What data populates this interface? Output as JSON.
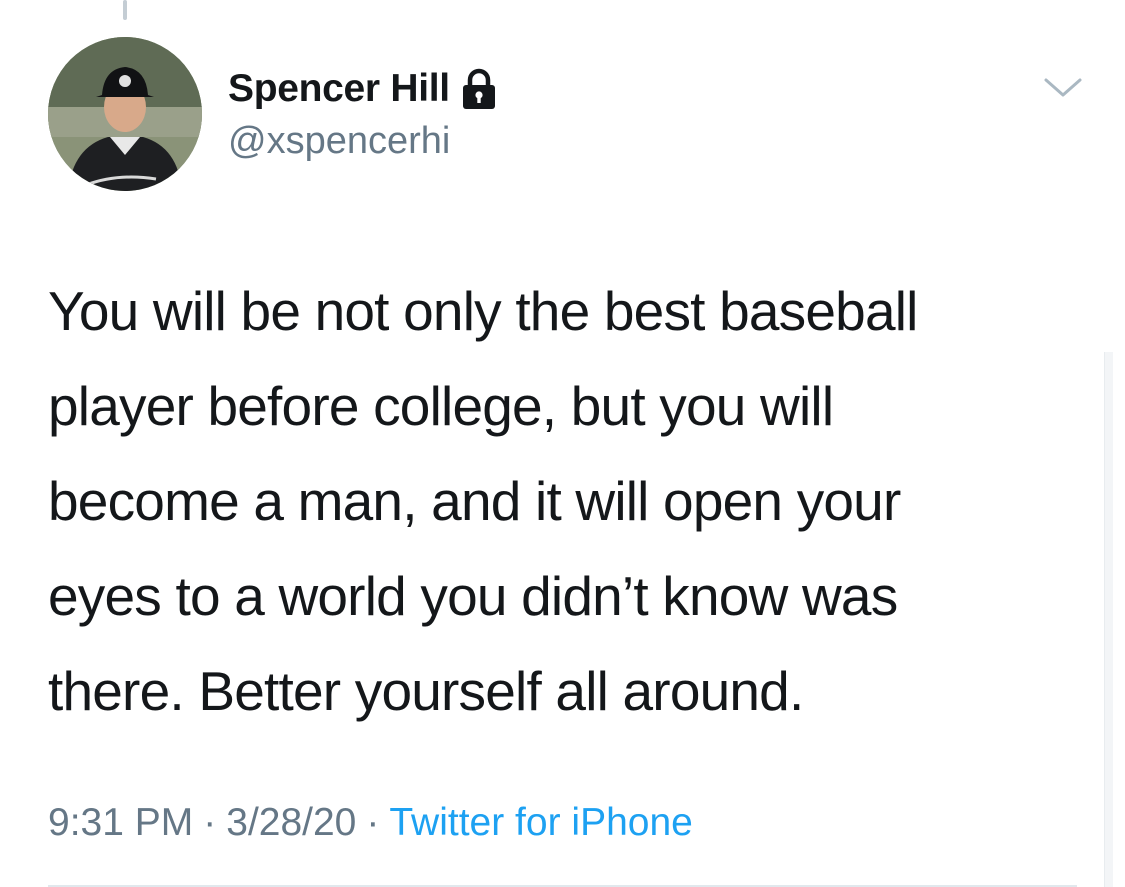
{
  "tweet": {
    "author": {
      "display_name": "Spencer Hill",
      "handle": "@xspencerhi",
      "protected_icon": "lock-icon",
      "avatar_icon": "profile-photo"
    },
    "text_lines": [
      "You will be not only the best baseball",
      "player before college, but you will",
      "become a man, and it will open your",
      "eyes to a world you didn’t know was",
      "there. Better yourself all around."
    ],
    "time": "9:31 PM",
    "date": "3/28/20",
    "separator": "·",
    "source": "Twitter for iPhone",
    "menu_icon": "chevron-down-icon"
  },
  "colors": {
    "text": "#14171a",
    "secondary": "#657786",
    "link": "#1da1f2",
    "divider": "#e1e8ed"
  }
}
